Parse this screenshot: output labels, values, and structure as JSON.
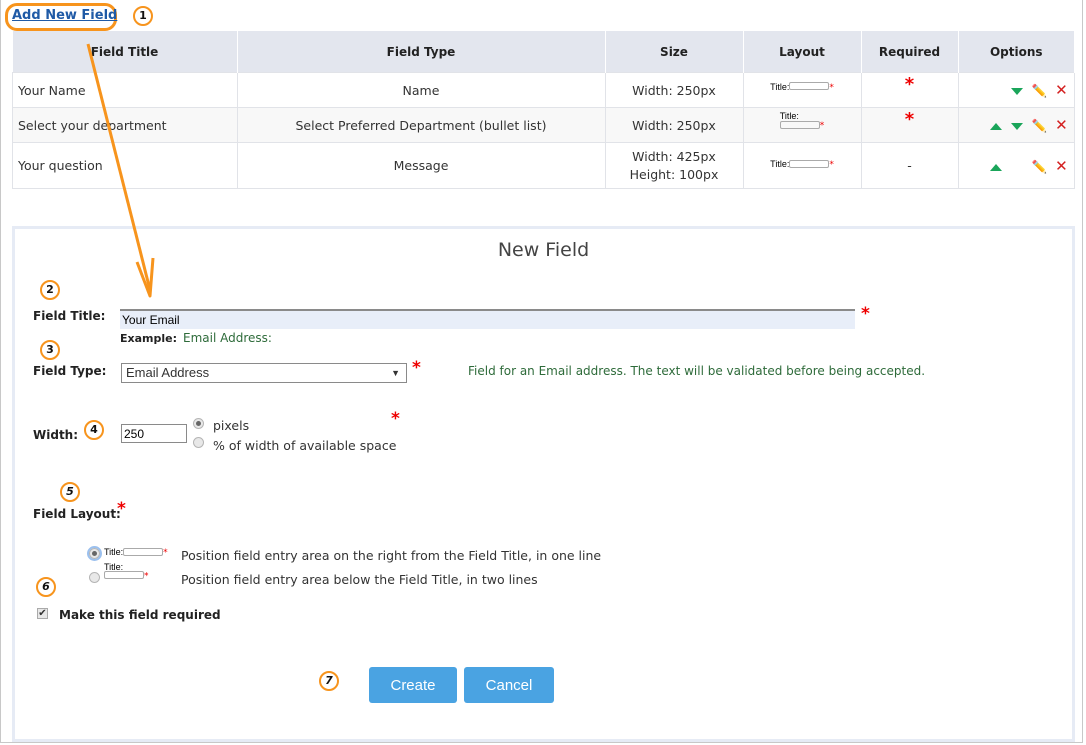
{
  "header": {
    "add_link": "Add New Field"
  },
  "annotations": [
    "1",
    "2",
    "3",
    "4",
    "5",
    "6",
    "7"
  ],
  "table": {
    "columns": [
      "Field Title",
      "Field Type",
      "Size",
      "Layout",
      "Required",
      "Options"
    ],
    "rows": [
      {
        "title": "Your Name",
        "type": "Name",
        "size_line1": "Width:  250px",
        "size_line2": "",
        "layout": "one-line",
        "layout_label": "Title:",
        "required": "*",
        "options": [
          "move-down",
          "edit",
          "delete"
        ]
      },
      {
        "title": "Select your department",
        "type": "Select Preferred Department (bullet list)",
        "size_line1": "Width:  250px",
        "size_line2": "",
        "layout": "two-line",
        "layout_label": "Title:",
        "required": "*",
        "options": [
          "move-up",
          "move-down",
          "edit",
          "delete"
        ]
      },
      {
        "title": "Your question",
        "type": "Message",
        "size_line1": "Width:  425px",
        "size_line2": "Height: 100px",
        "layout": "one-line",
        "layout_label": "Title:",
        "required": "-",
        "options": [
          "move-up",
          "edit",
          "delete"
        ]
      }
    ]
  },
  "form": {
    "title": "New Field",
    "field_title_label": "Field Title:",
    "field_title_value": "Your Email",
    "example_label": "Example:",
    "example_value": "Email Address:",
    "field_type_label": "Field Type:",
    "field_type_value": "Email Address",
    "field_type_hint": "Field for an Email address. The text will be validated before being accepted.",
    "width_label": "Width:",
    "width_value": "250",
    "width_unit_options": [
      "pixels",
      "% of width of available space"
    ],
    "width_unit_selected": "pixels",
    "layout_label": "Field Layout:",
    "layout_mini_label": "Title:",
    "layout_options": [
      "Position field entry area on the right from the Field Title, in one line",
      "Position field entry area below the Field Title, in two lines"
    ],
    "layout_selected": 0,
    "required_label": "Make this field required",
    "required_checked": true,
    "required_star": "*",
    "create_label": "Create",
    "cancel_label": "Cancel"
  },
  "colors": {
    "accent_orange": "#f7941d",
    "button_blue": "#4aa3e2",
    "link_blue": "#1f5aa6",
    "required_red": "#e00000",
    "hint_green": "#2e6b3a",
    "header_gray": "#e3e6ee"
  }
}
